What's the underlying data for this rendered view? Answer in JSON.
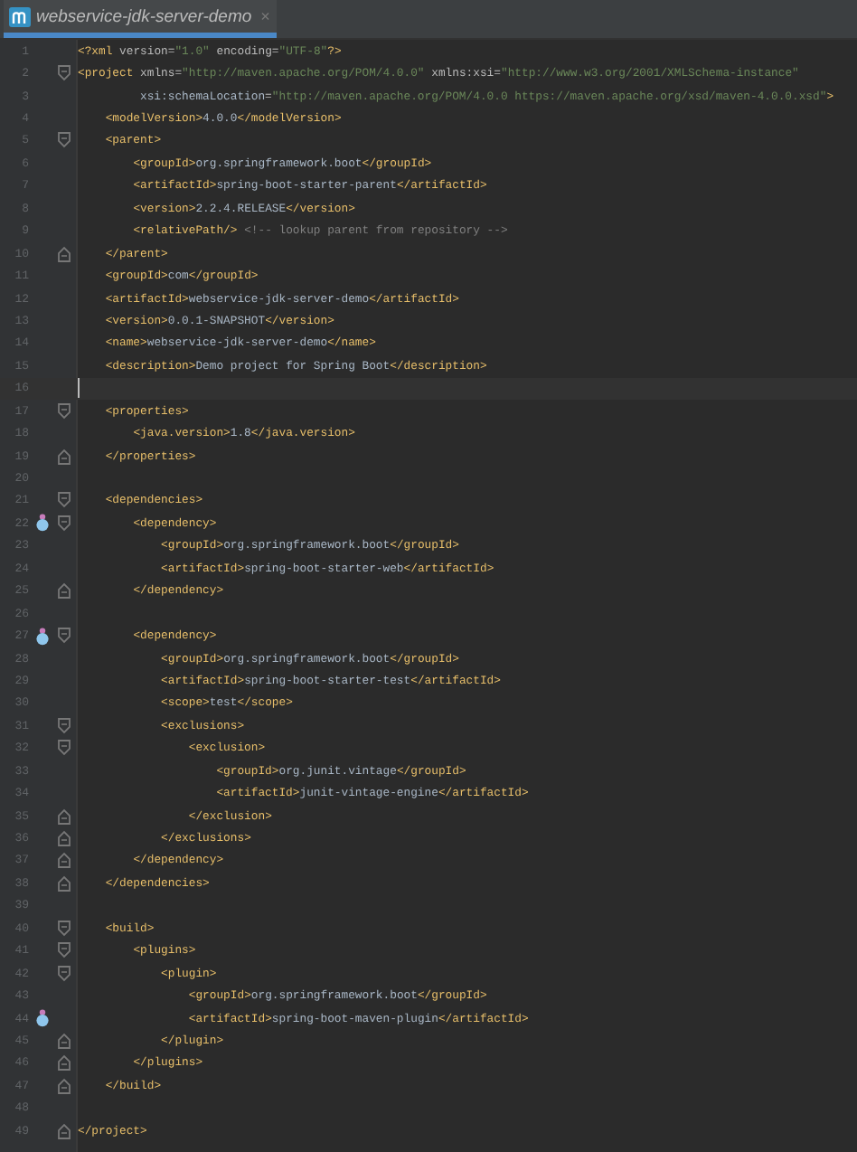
{
  "tabs": [
    {
      "label": "webservice-jdk-server-demo",
      "selected": true,
      "close": "×"
    }
  ],
  "lines": [
    {
      "number": "1",
      "code": "<?xml version=\"1.0\" encoding=\"UTF-8\"?>"
    },
    {
      "number": "2",
      "code": "<project xmlns=\"http://maven.apache.org/POM/4.0.0\" xmlns:xsi=\"http://www.w3.org/2001/XMLSchema-instance\"",
      "fold_start": true
    },
    {
      "number": "3",
      "code": "         xsi:schemaLocation=\"http://maven.apache.org/POM/4.0.0 https://maven.apache.org/xsd/maven-4.0.0.xsd\">"
    },
    {
      "number": "4",
      "code": "    <modelVersion>4.0.0</modelVersion>"
    },
    {
      "number": "5",
      "code": "    <parent>",
      "fold_start": true
    },
    {
      "number": "6",
      "code": "        <groupId>org.springframework.boot</groupId>"
    },
    {
      "number": "7",
      "code": "        <artifactId>spring-boot-starter-parent</artifactId>"
    },
    {
      "number": "8",
      "code": "        <version>2.2.4.RELEASE</version>"
    },
    {
      "number": "9",
      "code": "        <relativePath/> <!-- lookup parent from repository -->"
    },
    {
      "number": "10",
      "code": "    </parent>",
      "fold_end": true
    },
    {
      "number": "11",
      "code": "    <groupId>com</groupId>"
    },
    {
      "number": "12",
      "code": "    <artifactId>webservice-jdk-server-demo</artifactId>"
    },
    {
      "number": "13",
      "code": "    <version>0.0.1-SNAPSHOT</version>"
    },
    {
      "number": "14",
      "code": "    <name>webservice-jdk-server-demo</name>"
    },
    {
      "number": "15",
      "code": "    <description>Demo project for Spring Boot</description>"
    },
    {
      "number": "16",
      "current": true
    },
    {
      "number": "17",
      "code": "    <properties>",
      "fold_start": true
    },
    {
      "number": "18",
      "code": "        <java.version>1.8</java.version>"
    },
    {
      "number": "19",
      "code": "    </properties>",
      "fold_end": true
    },
    {
      "number": "20"
    },
    {
      "number": "21",
      "code": "    <dependencies>",
      "fold_start": true
    },
    {
      "number": "22",
      "code": "        <dependency>",
      "fold_start": true,
      "marker": true
    },
    {
      "number": "23",
      "code": "            <groupId>org.springframework.boot</groupId>"
    },
    {
      "number": "24",
      "code": "            <artifactId>spring-boot-starter-web</artifactId>"
    },
    {
      "number": "25",
      "code": "        </dependency>",
      "fold_end": true
    },
    {
      "number": "26"
    },
    {
      "number": "27",
      "code": "        <dependency>",
      "fold_start": true,
      "marker": true
    },
    {
      "number": "28",
      "code": "            <groupId>org.springframework.boot</groupId>"
    },
    {
      "number": "29",
      "code": "            <artifactId>spring-boot-starter-test</artifactId>"
    },
    {
      "number": "30",
      "code": "            <scope>test</scope>"
    },
    {
      "number": "31",
      "code": "            <exclusions>",
      "fold_start": true
    },
    {
      "number": "32",
      "code": "                <exclusion>",
      "fold_start": true
    },
    {
      "number": "33",
      "code": "                    <groupId>org.junit.vintage</groupId>"
    },
    {
      "number": "34",
      "code": "                    <artifactId>junit-vintage-engine</artifactId>"
    },
    {
      "number": "35",
      "code": "                </exclusion>",
      "fold_end": true
    },
    {
      "number": "36",
      "code": "            </exclusions>",
      "fold_end": true
    },
    {
      "number": "37",
      "code": "        </dependency>",
      "fold_end": true
    },
    {
      "number": "38",
      "code": "    </dependencies>",
      "fold_end": true
    },
    {
      "number": "39"
    },
    {
      "number": "40",
      "code": "    <build>",
      "fold_start": true
    },
    {
      "number": "41",
      "code": "        <plugins>",
      "fold_start": true
    },
    {
      "number": "42",
      "code": "            <plugin>",
      "fold_start": true
    },
    {
      "number": "43",
      "code": "                <groupId>org.springframework.boot</groupId>"
    },
    {
      "number": "44",
      "code": "                <artifactId>spring-boot-maven-plugin</artifactId>",
      "marker": true
    },
    {
      "number": "45",
      "code": "            </plugin>",
      "fold_end": true
    },
    {
      "number": "46",
      "code": "        </plugins>",
      "fold_end": true
    },
    {
      "number": "47",
      "code": "    </build>",
      "fold_end": true
    },
    {
      "number": "48"
    },
    {
      "number": "49",
      "code": "</project>",
      "fold_end": true
    }
  ]
}
